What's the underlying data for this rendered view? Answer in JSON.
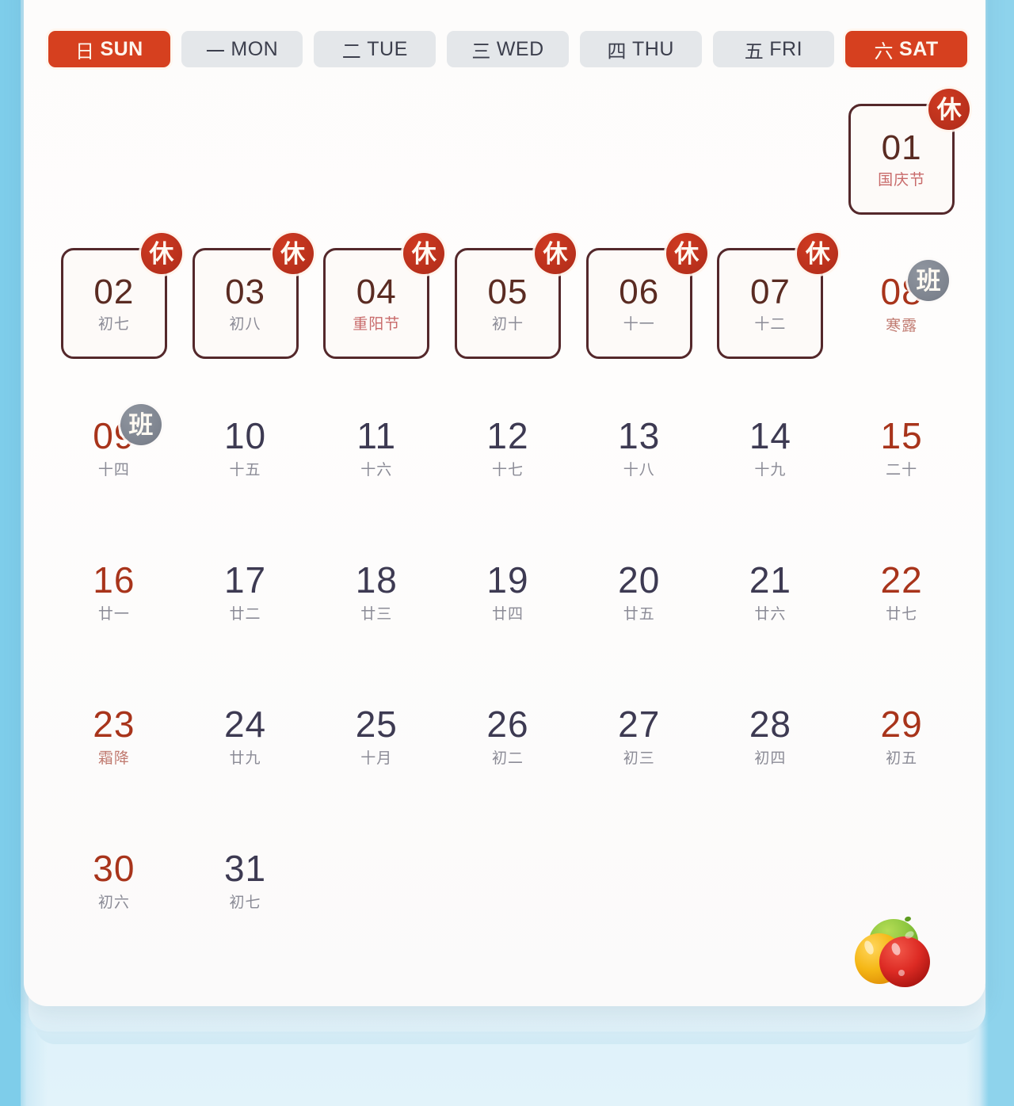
{
  "app": {
    "background_color": "#b3e0f2",
    "accent_color": "#d6401f",
    "card_color": "#fdfcfb"
  },
  "weekdays": [
    {
      "cn": "日",
      "en": "SUN",
      "weekend": true
    },
    {
      "cn": "一",
      "en": "MON",
      "weekend": false
    },
    {
      "cn": "二",
      "en": "TUE",
      "weekend": false
    },
    {
      "cn": "三",
      "en": "WED",
      "weekend": false
    },
    {
      "cn": "四",
      "en": "THU",
      "weekend": false
    },
    {
      "cn": "五",
      "en": "FRI",
      "weekend": false
    },
    {
      "cn": "六",
      "en": "SAT",
      "weekend": true
    }
  ],
  "badges": {
    "rest_label": "休",
    "work_label": "班"
  },
  "days": [
    {
      "day": "",
      "lunar": "",
      "empty": true
    },
    {
      "day": "",
      "lunar": "",
      "empty": true
    },
    {
      "day": "",
      "lunar": "",
      "empty": true
    },
    {
      "day": "",
      "lunar": "",
      "empty": true
    },
    {
      "day": "",
      "lunar": "",
      "empty": true
    },
    {
      "day": "",
      "lunar": "",
      "empty": true
    },
    {
      "day": "01",
      "lunar": "国庆节",
      "boxed": true,
      "badge": "rest",
      "lunar_style": "festival"
    },
    {
      "day": "02",
      "lunar": "初七",
      "boxed": true,
      "badge": "rest"
    },
    {
      "day": "03",
      "lunar": "初八",
      "boxed": true,
      "badge": "rest"
    },
    {
      "day": "04",
      "lunar": "重阳节",
      "boxed": true,
      "badge": "rest",
      "lunar_style": "festival"
    },
    {
      "day": "05",
      "lunar": "初十",
      "boxed": true,
      "badge": "rest"
    },
    {
      "day": "06",
      "lunar": "十一",
      "boxed": true,
      "badge": "rest"
    },
    {
      "day": "07",
      "lunar": "十二",
      "boxed": true,
      "badge": "rest"
    },
    {
      "day": "08",
      "lunar": "寒露",
      "badge": "work",
      "red": true,
      "lunar_style": "term"
    },
    {
      "day": "09",
      "lunar": "十四",
      "badge": "work",
      "red": true
    },
    {
      "day": "10",
      "lunar": "十五"
    },
    {
      "day": "11",
      "lunar": "十六"
    },
    {
      "day": "12",
      "lunar": "十七"
    },
    {
      "day": "13",
      "lunar": "十八"
    },
    {
      "day": "14",
      "lunar": "十九"
    },
    {
      "day": "15",
      "lunar": "二十",
      "red": true
    },
    {
      "day": "16",
      "lunar": "廿一",
      "red": true
    },
    {
      "day": "17",
      "lunar": "廿二"
    },
    {
      "day": "18",
      "lunar": "廿三"
    },
    {
      "day": "19",
      "lunar": "廿四"
    },
    {
      "day": "20",
      "lunar": "廿五"
    },
    {
      "day": "21",
      "lunar": "廿六"
    },
    {
      "day": "22",
      "lunar": "廿七",
      "red": true
    },
    {
      "day": "23",
      "lunar": "霜降",
      "red": true,
      "lunar_style": "term"
    },
    {
      "day": "24",
      "lunar": "廿九"
    },
    {
      "day": "25",
      "lunar": "十月"
    },
    {
      "day": "26",
      "lunar": "初二"
    },
    {
      "day": "27",
      "lunar": "初三"
    },
    {
      "day": "28",
      "lunar": "初四"
    },
    {
      "day": "29",
      "lunar": "初五",
      "red": true
    },
    {
      "day": "30",
      "lunar": "初六",
      "red": true
    },
    {
      "day": "31",
      "lunar": "初七"
    },
    {
      "day": "",
      "lunar": "",
      "empty": true
    },
    {
      "day": "",
      "lunar": "",
      "empty": true
    },
    {
      "day": "",
      "lunar": "",
      "empty": true
    },
    {
      "day": "",
      "lunar": "",
      "empty": true
    },
    {
      "day": "",
      "lunar": "",
      "empty": true
    }
  ],
  "decoration": {
    "name": "fruit-cluster",
    "colors": [
      "#8cc63f",
      "#f5b716",
      "#dd2b24"
    ]
  }
}
